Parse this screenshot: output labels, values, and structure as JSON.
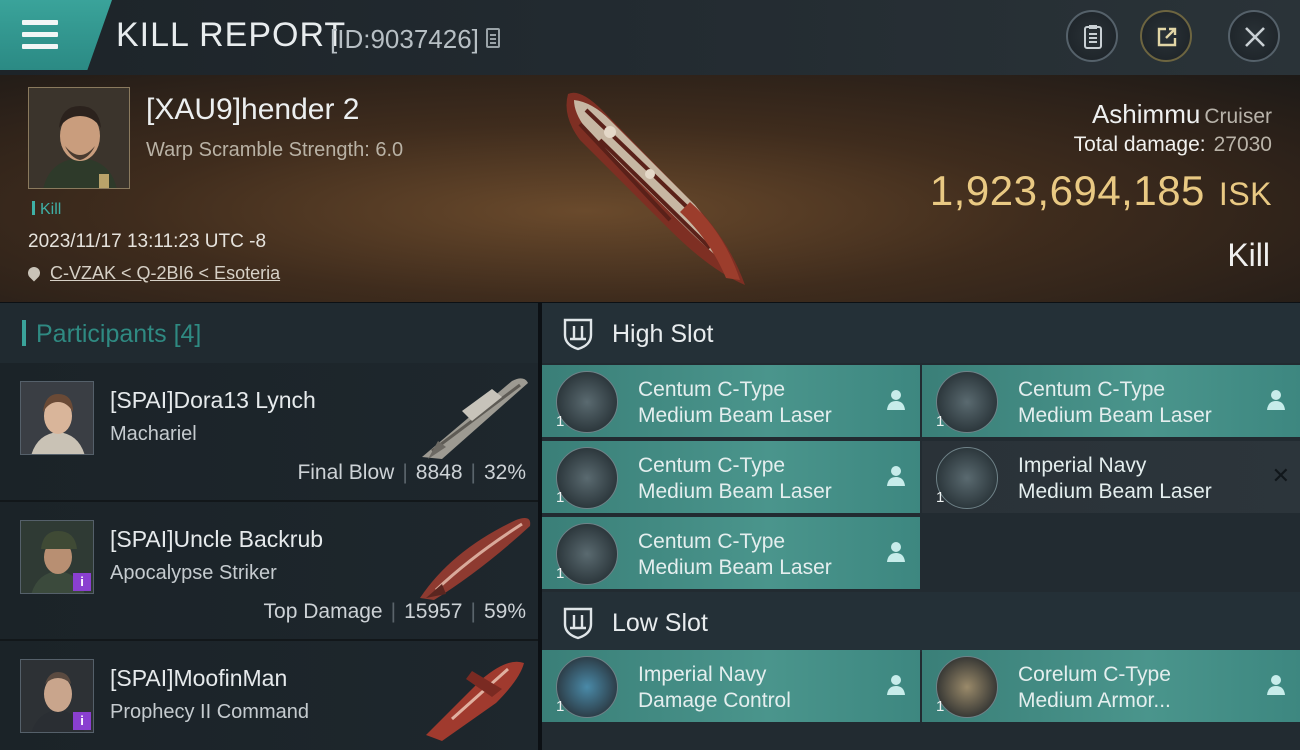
{
  "header": {
    "title": "KILL REPORT",
    "report_id": "[ID:9037426]",
    "icons": [
      "menu-icon",
      "copy-icon",
      "clipboard-icon",
      "share-icon",
      "close-icon"
    ]
  },
  "victim": {
    "name": "[XAU9]hender 2",
    "warp_scramble": "Warp Scramble Strength: 6.0",
    "kill_tag": "Kill",
    "timestamp": "2023/11/17 13:11:23 UTC -8",
    "location": "C-VZAK < Q-2BI6 < Esoteria",
    "ship": "Ashimmu",
    "ship_class": "Cruiser",
    "total_damage_label": "Total damage:",
    "total_damage": "27030",
    "isk_value": "1,923,694,185",
    "isk_unit": "ISK",
    "result": "Kill"
  },
  "participants": {
    "label": "Participants",
    "count": "[4]",
    "rows": [
      {
        "name": "[SPAI]Dora13 Lynch",
        "ship": "Machariel",
        "role": "Final Blow",
        "damage": "8848",
        "percent": "32%"
      },
      {
        "name": "[SPAI]Uncle Backrub",
        "ship": "Apocalypse Striker",
        "role": "Top Damage",
        "damage": "15957",
        "percent": "59%",
        "badge": "i"
      },
      {
        "name": "[SPAI]MoofinMan",
        "ship": "Prophecy II Command",
        "badge": "i"
      }
    ]
  },
  "fittings": {
    "high_slot_label": "High Slot",
    "low_slot_label": "Low Slot",
    "high": [
      {
        "qty": "1",
        "line1": "Centum C-Type",
        "line2": "Medium Beam Laser",
        "state": "dropped"
      },
      {
        "qty": "1",
        "line1": "Centum C-Type",
        "line2": "Medium Beam Laser",
        "state": "dropped"
      },
      {
        "qty": "1",
        "line1": "Centum C-Type",
        "line2": "Medium Beam Laser",
        "state": "dropped"
      },
      {
        "qty": "1",
        "line1": "Imperial Navy",
        "line2": "Medium Beam Laser",
        "state": "destroyed"
      },
      {
        "qty": "1",
        "line1": "Centum C-Type",
        "line2": "Medium Beam Laser",
        "state": "dropped"
      }
    ],
    "low": [
      {
        "qty": "1",
        "line1": "Imperial Navy",
        "line2": "Damage Control",
        "state": "dropped"
      },
      {
        "qty": "1",
        "line1": "Corelum C-Type",
        "line2": "Medium Armor...",
        "state": "dropped"
      }
    ]
  },
  "colors": {
    "accent": "#3aa39a",
    "isk_gold": "#e9c983",
    "module_dropped": "#4a958c",
    "module_destroyed": "#2c353b",
    "badge": "#8a3fd0"
  }
}
